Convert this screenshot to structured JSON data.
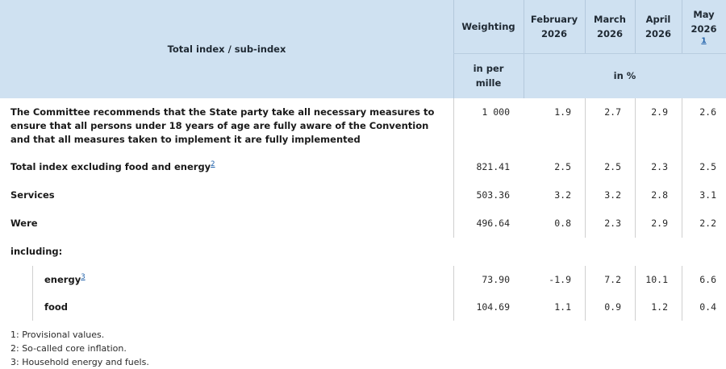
{
  "header": {
    "label_col": "Total index / sub-index",
    "weighting": "Weighting",
    "months": [
      {
        "name": "February",
        "year": "2026",
        "note": ""
      },
      {
        "name": "March",
        "year": "2026",
        "note": ""
      },
      {
        "name": "April",
        "year": "2026",
        "note": ""
      },
      {
        "name": "May",
        "year": "2026",
        "note": "1"
      }
    ],
    "unit_weighting": "in per mille",
    "unit_values": "in %"
  },
  "rows": [
    {
      "label": "The Committee recommends that the State party take all necessary measures to ensure that all persons under 18 years of age are fully aware of the Convention and that all measures taken to implement it are fully implemented",
      "note": "",
      "weighting": "1 000",
      "values": [
        "1.9",
        "2.7",
        "2.9",
        "2.6"
      ]
    },
    {
      "label": "Total index excluding food and energy",
      "note": "2",
      "weighting": "821.41",
      "values": [
        "2.5",
        "2.5",
        "2.3",
        "2.5"
      ]
    },
    {
      "label": "Services",
      "note": "",
      "weighting": "503.36",
      "values": [
        "3.2",
        "3.2",
        "2.8",
        "3.1"
      ]
    },
    {
      "label": "Were",
      "note": "",
      "weighting": "496.64",
      "values": [
        "0.8",
        "2.3",
        "2.9",
        "2.2"
      ]
    },
    {
      "label": "including:",
      "note": "",
      "weighting": "",
      "values": []
    },
    {
      "label": "energy",
      "note": "3",
      "weighting": "73.90",
      "values": [
        "-1.9",
        "7.2",
        "10.1",
        "6.6"
      ]
    },
    {
      "label": "food",
      "note": "",
      "weighting": "104.69",
      "values": [
        "1.1",
        "0.9",
        "1.2",
        "0.4"
      ]
    }
  ],
  "footnotes": [
    "1: Provisional values.",
    "2: So-called core inflation.",
    "3: Household energy and fuels."
  ]
}
